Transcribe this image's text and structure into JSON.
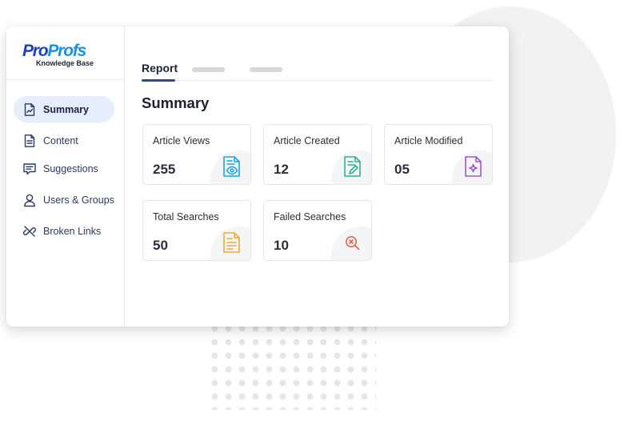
{
  "brand": {
    "logo_text_a": "Pro",
    "logo_text_b": "Profs",
    "logo_subtitle": "Knowledge Base"
  },
  "sidebar": {
    "items": [
      {
        "label": "Summary",
        "icon": "chart-doc-icon",
        "active": true
      },
      {
        "label": "Content",
        "icon": "document-icon",
        "active": false
      },
      {
        "label": "Suggestions",
        "icon": "message-icon",
        "active": false
      },
      {
        "label": "Users & Groups",
        "icon": "user-icon",
        "active": false
      },
      {
        "label": "Broken Links",
        "icon": "broken-link-icon",
        "active": false
      }
    ]
  },
  "tabs": {
    "active_label": "Report"
  },
  "main": {
    "title": "Summary"
  },
  "stats": [
    {
      "label": "Article Views",
      "value": "255",
      "icon": "document-eye-icon",
      "color": "#1aa3df"
    },
    {
      "label": "Article Created",
      "value": "12",
      "icon": "document-edit-icon",
      "color": "#2fb38a"
    },
    {
      "label": "Article Modified",
      "value": "05",
      "icon": "document-sparkle-icon",
      "color": "#9b59d0"
    },
    {
      "label": "Total Searches",
      "value": "50",
      "icon": "document-lines-icon",
      "color": "#f2a73a"
    },
    {
      "label": "Failed Searches",
      "value": "10",
      "icon": "search-fail-icon",
      "color": "#e0614f"
    }
  ],
  "colors": {
    "accent": "#2b4a8e",
    "active_bg": "#e6eefc",
    "brand_dark": "#1e3fb8",
    "brand_light": "#1f8fe0"
  }
}
